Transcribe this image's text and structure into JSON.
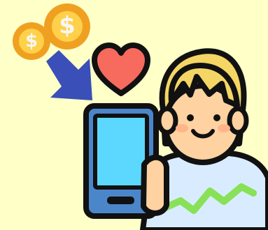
{
  "illustration": {
    "background_color": "#FFFFC8",
    "outline_color": "#111111",
    "coin_colors": {
      "outer": "#F0A020",
      "face": "#FFD04A",
      "symbol": "#F7F7F2"
    },
    "coin_symbol": "$",
    "arrow_color": "#3A4FB7",
    "heart_color": "#F76A5E",
    "phone_colors": {
      "body": "#4B86CB",
      "screen": "#5CD8FF",
      "button": "#111111"
    },
    "person_colors": {
      "hair": "#F5D564",
      "skin": "#FFD2A1",
      "shirt": "#D9ECFF",
      "shirt_stripe": "#88E157",
      "cheek": "#FFB58A"
    },
    "icons": [
      "coin-icon",
      "arrow-down-right-icon",
      "heart-icon",
      "smartphone-icon",
      "person-icon"
    ]
  }
}
